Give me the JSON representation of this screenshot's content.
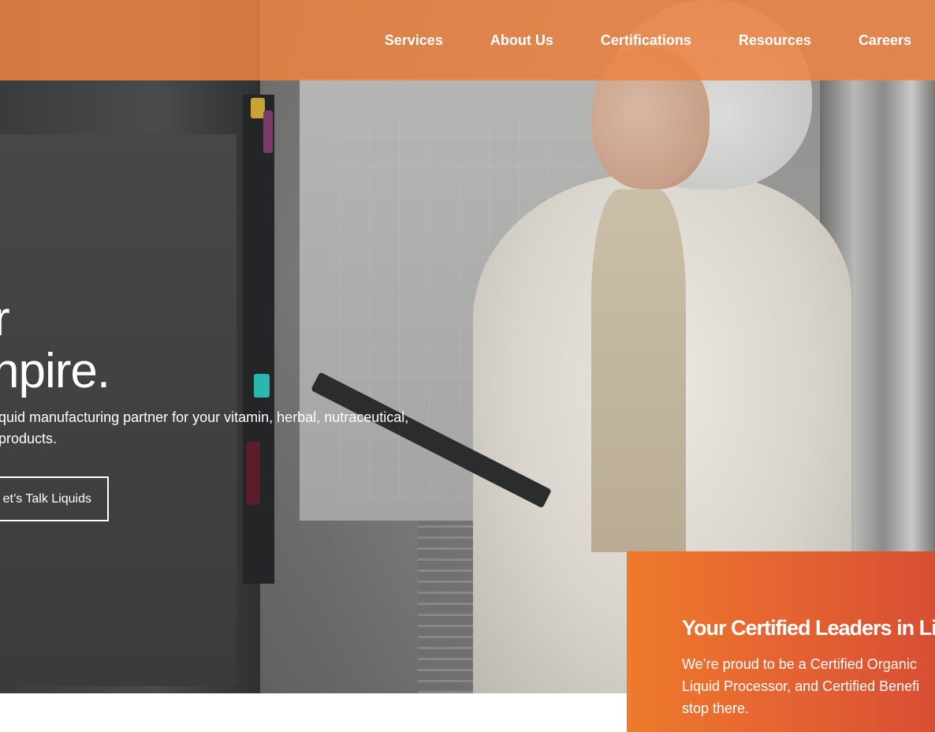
{
  "nav": {
    "items": [
      {
        "label": "Services"
      },
      {
        "label": "About Us"
      },
      {
        "label": "Certifications"
      },
      {
        "label": "Resources"
      },
      {
        "label": "Careers"
      }
    ]
  },
  "hero": {
    "headline_line1": "r",
    "headline_line2": "npire.",
    "subcopy_line1": "iquid manufacturing partner for your vitamin, herbal, nutraceutical,",
    "subcopy_line2": "products.",
    "cta_label": "et’s Talk Liquids"
  },
  "cert_card": {
    "title": "Your Certified Leaders in Li",
    "body_line1": "We’re proud to be a Certified Organic",
    "body_line2": "Liquid Processor, and Certified Benefi",
    "body_line3": "stop there."
  },
  "colors": {
    "header_orange": "#ec8442",
    "card_orange_start": "#ee7a2c",
    "card_orange_end": "#d84e33",
    "text_white": "#ffffff"
  }
}
